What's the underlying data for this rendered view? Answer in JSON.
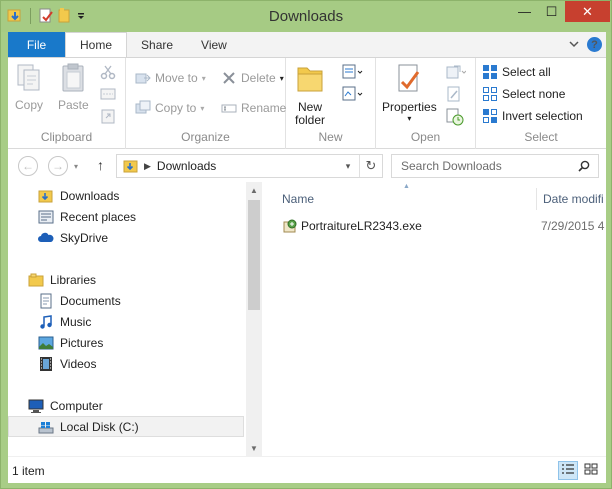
{
  "window": {
    "title": "Downloads",
    "controls": {
      "minimize": "—",
      "maximize": "☐",
      "close": "✕"
    }
  },
  "tabs": [
    {
      "label": "File"
    },
    {
      "label": "Home"
    },
    {
      "label": "Share"
    },
    {
      "label": "View"
    }
  ],
  "ribbon": {
    "clipboard": {
      "label": "Clipboard",
      "copy": "Copy",
      "paste": "Paste"
    },
    "organize": {
      "label": "Organize",
      "move_to": "Move to",
      "copy_to": "Copy to",
      "delete": "Delete",
      "rename": "Rename"
    },
    "new": {
      "label": "New",
      "new_folder_line1": "New",
      "new_folder_line2": "folder"
    },
    "open": {
      "label": "Open",
      "properties": "Properties"
    },
    "select": {
      "label": "Select",
      "select_all": "Select all",
      "select_none": "Select none",
      "invert_selection": "Invert selection"
    }
  },
  "address": {
    "path": "Downloads",
    "search_placeholder": "Search Downloads"
  },
  "nav": {
    "favorites": [
      {
        "label": "Downloads",
        "icon": "downloads-folder-icon"
      },
      {
        "label": "Recent places",
        "icon": "recent-places-icon"
      },
      {
        "label": "SkyDrive",
        "icon": "skydrive-icon"
      }
    ],
    "libraries_label": "Libraries",
    "libraries": [
      {
        "label": "Documents",
        "icon": "documents-icon"
      },
      {
        "label": "Music",
        "icon": "music-icon"
      },
      {
        "label": "Pictures",
        "icon": "pictures-icon"
      },
      {
        "label": "Videos",
        "icon": "videos-icon"
      }
    ],
    "computer_label": "Computer",
    "drives": [
      {
        "label": "Local Disk (C:)",
        "icon": "local-disk-icon",
        "selected": true
      }
    ]
  },
  "files": {
    "columns": {
      "name": "Name",
      "date": "Date modifi"
    },
    "rows": [
      {
        "name": "PortraitureLR2343.exe",
        "date": "7/29/2015 4"
      }
    ]
  },
  "status": {
    "text": "1 item"
  },
  "colors": {
    "frame": "#a8cd86",
    "file_tab": "#1979ca",
    "close_button": "#c7402f",
    "folder_yellow": "#f2c94c"
  }
}
